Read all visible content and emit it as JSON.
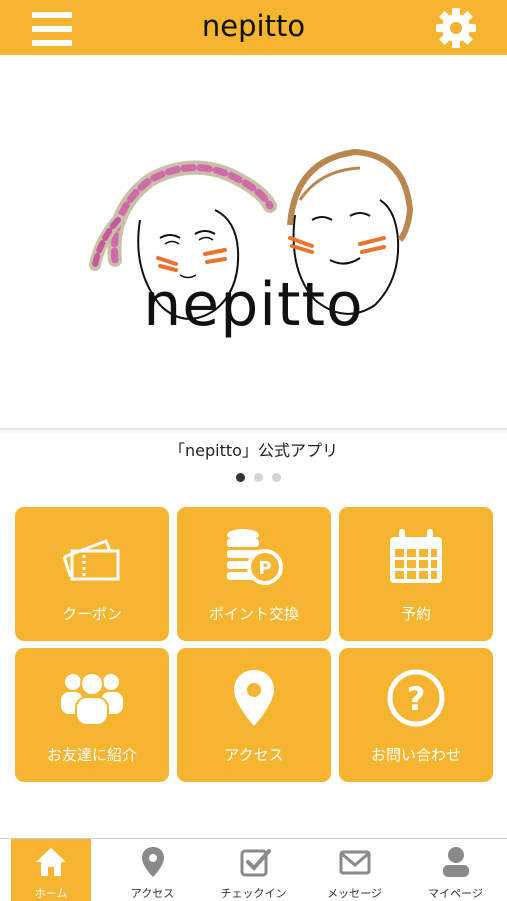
{
  "header": {
    "title": "nepitto"
  },
  "hero": {
    "brand": "nepitto",
    "caption": "「nepitto」公式アプリ",
    "slide_count": 3,
    "active_slide": 1
  },
  "tiles": [
    {
      "label": "クーポン",
      "icon": "ticket-icon"
    },
    {
      "label": "ポイント交換",
      "icon": "coin-point-icon"
    },
    {
      "label": "予約",
      "icon": "calendar-icon"
    },
    {
      "label": "お友達に紹介",
      "icon": "people-icon"
    },
    {
      "label": "アクセス",
      "icon": "map-pin-icon"
    },
    {
      "label": "お問い合わせ",
      "icon": "question-icon"
    }
  ],
  "tabs": [
    {
      "label": "ホーム",
      "icon": "home-icon",
      "active": true
    },
    {
      "label": "アクセス",
      "icon": "map-pin-icon"
    },
    {
      "label": "チェックイン",
      "icon": "checkin-icon"
    },
    {
      "label": "メッセージ",
      "icon": "mail-icon"
    },
    {
      "label": "マイページ",
      "icon": "user-icon"
    }
  ],
  "colors": {
    "accent": "#f5b530",
    "tab_icon": "#8a8a8a"
  }
}
